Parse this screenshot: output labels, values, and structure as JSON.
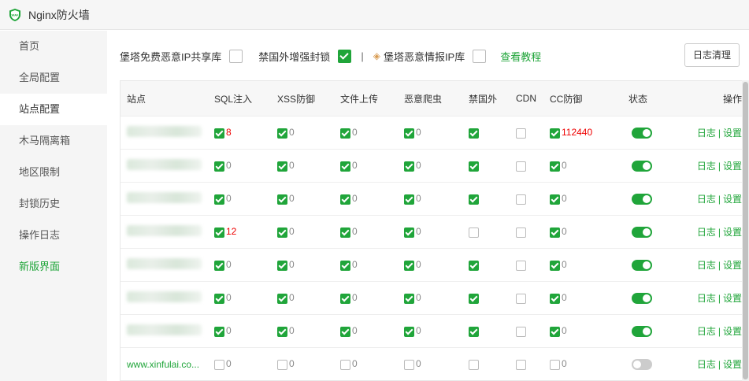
{
  "app": {
    "title": "Nginx防火墙"
  },
  "sidebar": {
    "items": [
      {
        "label": "首页",
        "active": false,
        "green": false
      },
      {
        "label": "全局配置",
        "active": false,
        "green": false
      },
      {
        "label": "站点配置",
        "active": true,
        "green": false
      },
      {
        "label": "木马隔离箱",
        "active": false,
        "green": false
      },
      {
        "label": "地区限制",
        "active": false,
        "green": false
      },
      {
        "label": "封锁历史",
        "active": false,
        "green": false
      },
      {
        "label": "操作日志",
        "active": false,
        "green": false
      },
      {
        "label": "新版界面",
        "active": false,
        "green": true
      }
    ]
  },
  "toolbar": {
    "share_label": "堡塔免费恶意IP共享库",
    "share_checked": false,
    "cn_block_label": "禁国外增强封锁",
    "cn_block_checked": true,
    "separator": "|",
    "intel_label": "堡塔恶意情报IP库",
    "intel_checked": false,
    "tutorial_link": "查看教程",
    "log_clear_button": "日志清理"
  },
  "table": {
    "headers": [
      "站点",
      "SQL注入",
      "XSS防御",
      "文件上传",
      "恶意爬虫",
      "禁国外",
      "CDN",
      "CC防御",
      "状态",
      "操作"
    ],
    "op_log": "日志",
    "op_sep": "|",
    "op_settings": "设置",
    "rows": [
      {
        "site": "",
        "sql": [
          true,
          "8"
        ],
        "xss": [
          true,
          "0"
        ],
        "upload": [
          true,
          "0"
        ],
        "bot": [
          true,
          "0"
        ],
        "cn": true,
        "cdn": false,
        "cc": [
          true,
          "112440"
        ],
        "status": true
      },
      {
        "site": "",
        "sql": [
          true,
          "0"
        ],
        "xss": [
          true,
          "0"
        ],
        "upload": [
          true,
          "0"
        ],
        "bot": [
          true,
          "0"
        ],
        "cn": true,
        "cdn": false,
        "cc": [
          true,
          "0"
        ],
        "status": true
      },
      {
        "site": "",
        "sql": [
          true,
          "0"
        ],
        "xss": [
          true,
          "0"
        ],
        "upload": [
          true,
          "0"
        ],
        "bot": [
          true,
          "0"
        ],
        "cn": true,
        "cdn": false,
        "cc": [
          true,
          "0"
        ],
        "status": true
      },
      {
        "site": "",
        "sql": [
          true,
          "12"
        ],
        "xss": [
          true,
          "0"
        ],
        "upload": [
          true,
          "0"
        ],
        "bot": [
          true,
          "0"
        ],
        "cn": false,
        "cdn": false,
        "cc": [
          true,
          "0"
        ],
        "status": true
      },
      {
        "site": "",
        "sql": [
          true,
          "0"
        ],
        "xss": [
          true,
          "0"
        ],
        "upload": [
          true,
          "0"
        ],
        "bot": [
          true,
          "0"
        ],
        "cn": true,
        "cdn": false,
        "cc": [
          true,
          "0"
        ],
        "status": true
      },
      {
        "site": "",
        "sql": [
          true,
          "0"
        ],
        "xss": [
          true,
          "0"
        ],
        "upload": [
          true,
          "0"
        ],
        "bot": [
          true,
          "0"
        ],
        "cn": true,
        "cdn": false,
        "cc": [
          true,
          "0"
        ],
        "status": true
      },
      {
        "site": "",
        "sql": [
          true,
          "0"
        ],
        "xss": [
          true,
          "0"
        ],
        "upload": [
          true,
          "0"
        ],
        "bot": [
          true,
          "0"
        ],
        "cn": true,
        "cdn": false,
        "cc": [
          true,
          "0"
        ],
        "status": true
      },
      {
        "site": "www.xinfulai.co...",
        "sql": [
          false,
          "0"
        ],
        "xss": [
          false,
          "0"
        ],
        "upload": [
          false,
          "0"
        ],
        "bot": [
          false,
          "0"
        ],
        "cn": false,
        "cdn": false,
        "cc": [
          false,
          "0"
        ],
        "status": false
      }
    ]
  },
  "colors": {
    "accent": "#20a53a",
    "alert": "#e00000"
  }
}
